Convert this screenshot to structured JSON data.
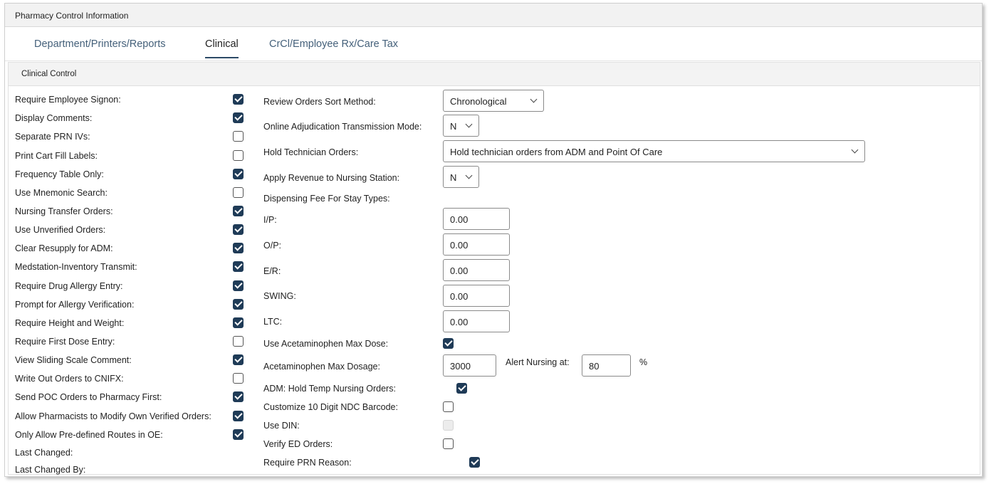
{
  "window_title": "Pharmacy Control Information",
  "tabs": [
    {
      "label": "Department/Printers/Reports"
    },
    {
      "label": "Clinical"
    },
    {
      "label": "CrCl/Employee Rx/Care Tax"
    }
  ],
  "panel_title": "Clinical Control",
  "left_fields": [
    {
      "label": "Require Employee Signon:",
      "checked": true
    },
    {
      "label": "Display Comments:",
      "checked": true
    },
    {
      "label": "Separate PRN IVs:",
      "checked": false
    },
    {
      "label": "Print Cart Fill Labels:",
      "checked": false
    },
    {
      "label": "Frequency Table Only:",
      "checked": true
    },
    {
      "label": "Use Mnemonic Search:",
      "checked": false
    },
    {
      "label": "Nursing Transfer Orders:",
      "checked": true
    },
    {
      "label": "Use Unverified Orders:",
      "checked": true
    },
    {
      "label": "Clear Resupply for ADM:",
      "checked": true
    },
    {
      "label": "Medstation-Inventory Transmit:",
      "checked": true
    },
    {
      "label": "Require Drug Allergy Entry:",
      "checked": true
    },
    {
      "label": "Prompt for Allergy Verification:",
      "checked": true
    },
    {
      "label": "Require Height and Weight:",
      "checked": true
    },
    {
      "label": "Require First Dose Entry:",
      "checked": false
    },
    {
      "label": "View Sliding Scale Comment:",
      "checked": true
    },
    {
      "label": "Write Out Orders to CNIFX:",
      "checked": false
    },
    {
      "label": "Send POC Orders to Pharmacy First:",
      "checked": true
    },
    {
      "label": "Allow Pharmacists to Modify Own Verified Orders:",
      "checked": true
    },
    {
      "label": "Only Allow Pre-defined Routes in OE:",
      "checked": true
    }
  ],
  "last_changed_label": "Last Changed:",
  "last_changed_by_label": "Last Changed By:",
  "right": {
    "review_sort_label": "Review Orders Sort Method:",
    "review_sort_value": "Chronological",
    "online_adj_label": "Online Adjudication Transmission Mode:",
    "online_adj_value": "N",
    "hold_tech_label": "Hold Technician Orders:",
    "hold_tech_value": "Hold technician orders from ADM and Point Of Care",
    "apply_rev_label": "Apply Revenue to Nursing Station:",
    "apply_rev_value": "N",
    "disp_fee_label": "Dispensing Fee For Stay Types:",
    "ip_label": "I/P:",
    "ip_value": "0.00",
    "op_label": "O/P:",
    "op_value": "0.00",
    "er_label": "E/R:",
    "er_value": "0.00",
    "swing_label": "SWING:",
    "swing_value": "0.00",
    "ltc_label": "LTC:",
    "ltc_value": "0.00",
    "acet_max_use_label": "Use Acetaminophen Max Dose:",
    "acet_max_use_checked": true,
    "acet_max_dosage_label": "Acetaminophen Max Dosage:",
    "acet_max_dosage_value": "3000",
    "alert_nursing_label": "Alert Nursing at:",
    "alert_nursing_value": "80",
    "percent_label": "%",
    "adm_hold_label": "ADM: Hold Temp Nursing Orders:",
    "adm_hold_checked": true,
    "ndc_label": "Customize 10 Digit NDC Barcode:",
    "ndc_checked": false,
    "din_label": "Use DIN:",
    "din_checked": false,
    "verify_ed_label": "Verify ED Orders:",
    "verify_ed_checked": false,
    "prn_reason_label": "Require PRN Reason:",
    "prn_reason_checked": true
  }
}
